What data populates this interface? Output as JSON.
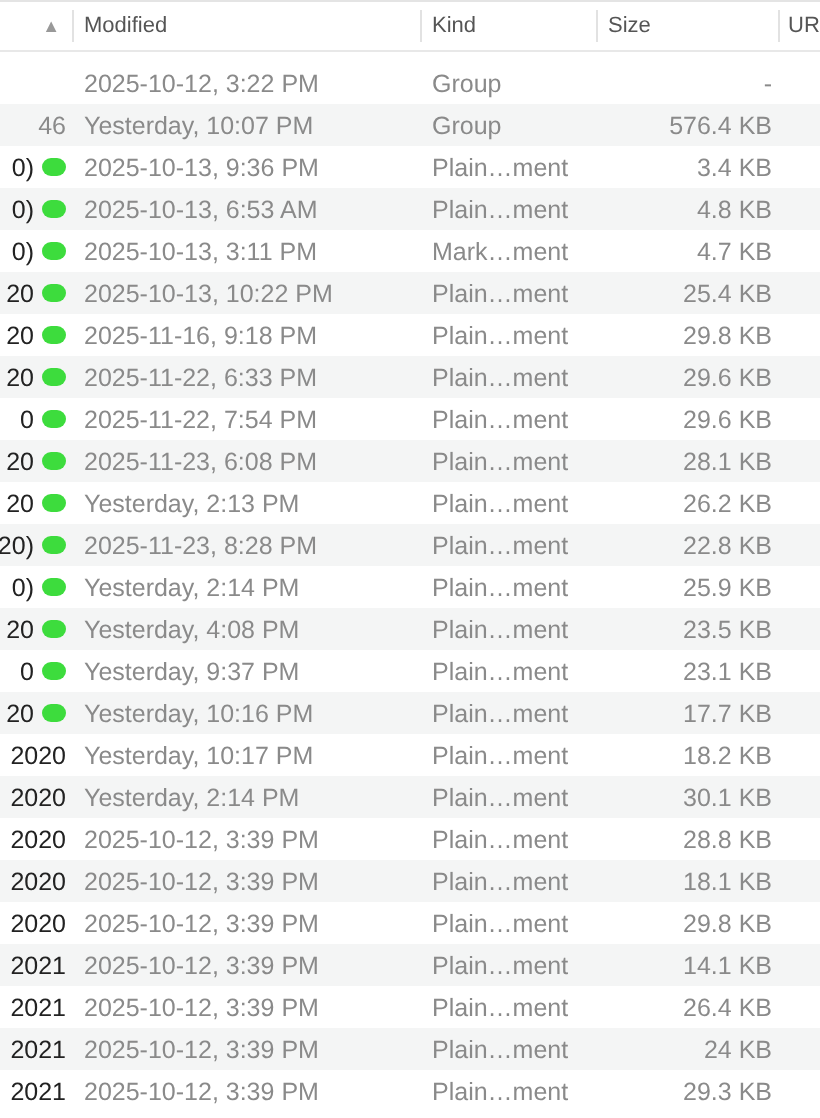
{
  "header": {
    "sort_indicator": "▲",
    "columns": [
      "Modified",
      "Kind",
      "Size",
      "UR"
    ]
  },
  "rows": [
    {
      "modified": "2025-10-12, 3:22 PM",
      "kind": "Group",
      "size": "-"
    },
    {
      "count": "46",
      "modified": "Yesterday, 10:07 PM",
      "kind": "Group",
      "size": "576.4 KB"
    },
    {
      "name": "0)",
      "color": "#3ddc3d",
      "modified": "2025-10-13, 9:36 PM",
      "kind": "Plain…ment",
      "size": "3.4 KB"
    },
    {
      "name": "0)",
      "color": "#3ddc3d",
      "modified": "2025-10-13, 6:53 AM",
      "kind": "Plain…ment",
      "size": "4.8 KB"
    },
    {
      "name": "0)",
      "color": "#3ddc3d",
      "modified": "2025-10-13, 3:11 PM",
      "kind": "Mark…ment",
      "size": "4.7 KB"
    },
    {
      "name": "20",
      "color": "#3ddc3d",
      "modified": "2025-10-13, 10:22 PM",
      "kind": "Plain…ment",
      "size": "25.4 KB"
    },
    {
      "name": "20",
      "color": "#3ddc3d",
      "modified": "2025-11-16, 9:18 PM",
      "kind": "Plain…ment",
      "size": "29.8 KB"
    },
    {
      "name": "20",
      "color": "#3ddc3d",
      "modified": "2025-11-22, 6:33 PM",
      "kind": "Plain…ment",
      "size": "29.6 KB"
    },
    {
      "name": "0",
      "color": "#3ddc3d",
      "modified": "2025-11-22, 7:54 PM",
      "kind": "Plain…ment",
      "size": "29.6 KB"
    },
    {
      "name": "20",
      "color": "#3ddc3d",
      "modified": "2025-11-23, 6:08 PM",
      "kind": "Plain…ment",
      "size": "28.1 KB"
    },
    {
      "name": "20",
      "color": "#3ddc3d",
      "modified": "Yesterday, 2:13 PM",
      "kind": "Plain…ment",
      "size": "26.2 KB"
    },
    {
      "name": "20)",
      "color": "#3ddc3d",
      "modified": "2025-11-23, 8:28 PM",
      "kind": "Plain…ment",
      "size": "22.8 KB"
    },
    {
      "name": "0)",
      "color": "#3ddc3d",
      "modified": "Yesterday, 2:14 PM",
      "kind": "Plain…ment",
      "size": "25.9 KB"
    },
    {
      "name": "20",
      "color": "#3ddc3d",
      "modified": "Yesterday, 4:08 PM",
      "kind": "Plain…ment",
      "size": "23.5 KB"
    },
    {
      "name": "0",
      "color": "#3ddc3d",
      "modified": "Yesterday, 9:37 PM",
      "kind": "Plain…ment",
      "size": "23.1 KB"
    },
    {
      "name": "20",
      "color": "#3ddc3d",
      "modified": "Yesterday, 10:16 PM",
      "kind": "Plain…ment",
      "size": "17.7 KB"
    },
    {
      "name": "2020",
      "modified": "Yesterday, 10:17 PM",
      "kind": "Plain…ment",
      "size": "18.2 KB"
    },
    {
      "name": "2020",
      "modified": "Yesterday, 2:14 PM",
      "kind": "Plain…ment",
      "size": "30.1 KB"
    },
    {
      "name": "2020",
      "modified": "2025-10-12, 3:39 PM",
      "kind": "Plain…ment",
      "size": "28.8 KB"
    },
    {
      "name": "2020",
      "modified": "2025-10-12, 3:39 PM",
      "kind": "Plain…ment",
      "size": "18.1 KB"
    },
    {
      "name": "2020",
      "modified": "2025-10-12, 3:39 PM",
      "kind": "Plain…ment",
      "size": "29.8 KB"
    },
    {
      "name": "2021",
      "modified": "2025-10-12, 3:39 PM",
      "kind": "Plain…ment",
      "size": "14.1 KB"
    },
    {
      "name": "2021",
      "modified": "2025-10-12, 3:39 PM",
      "kind": "Plain…ment",
      "size": "26.4 KB"
    },
    {
      "name": "2021",
      "modified": "2025-10-12, 3:39 PM",
      "kind": "Plain…ment",
      "size": "24 KB"
    },
    {
      "name": "2021",
      "modified": "2025-10-12, 3:39 PM",
      "kind": "Plain…ment",
      "size": "29.3 KB"
    }
  ]
}
